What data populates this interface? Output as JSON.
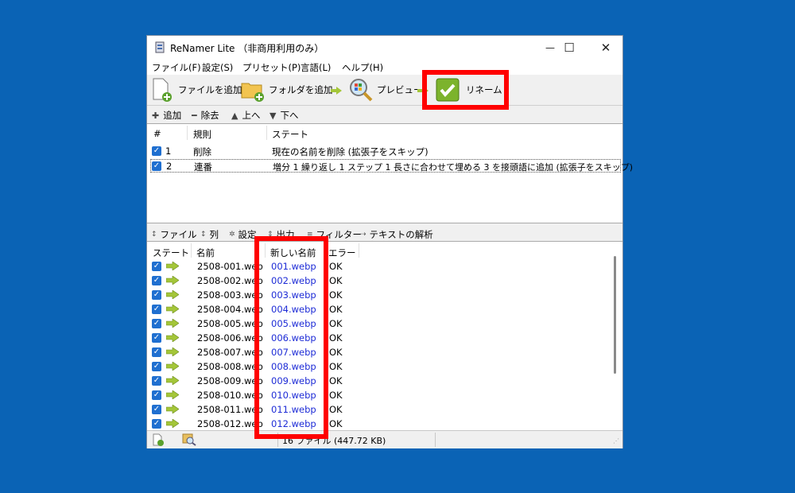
{
  "window": {
    "title": "ReNamer Lite （非商用利用のみ）",
    "minimize": "—",
    "maximize": "☐",
    "close": "✕"
  },
  "menu": [
    "ファイル(F)",
    "設定(S)",
    "プリセット(P)",
    "言語(L)",
    "ヘルプ(H)"
  ],
  "toolbar": {
    "add_files": "ファイルを追加",
    "add_folder": "フォルダを追加",
    "preview": "プレビュー",
    "rename": "リネーム"
  },
  "rules_toolbar": {
    "add": "追加",
    "remove": "除去",
    "up": "上へ",
    "down": "下へ"
  },
  "rules": {
    "headers": {
      "num": "#",
      "rule": "規則",
      "state": "ステート"
    },
    "rows": [
      {
        "num": "1",
        "rule": "削除",
        "state": "現在の名前を削除 (拡張子をスキップ)"
      },
      {
        "num": "2",
        "rule": "連番",
        "state": "増分 1 繰り返し 1 ステップ 1 長さに合わせて埋める 3 を接頭語に追加 (拡張子をスキップ)"
      }
    ]
  },
  "file_tabs": [
    "ファイル",
    "列",
    "設定",
    "出力",
    "フィルター",
    "テキストの解析"
  ],
  "files": {
    "headers": {
      "state": "ステート",
      "name": "名前",
      "new_name": "新しい名前",
      "error": "エラー"
    },
    "rows": [
      {
        "name": "2508-001.web",
        "new_name": "001.webp",
        "error": "OK"
      },
      {
        "name": "2508-002.web",
        "new_name": "002.webp",
        "error": "OK"
      },
      {
        "name": "2508-003.web",
        "new_name": "003.webp",
        "error": "OK"
      },
      {
        "name": "2508-004.web",
        "new_name": "004.webp",
        "error": "OK"
      },
      {
        "name": "2508-005.web",
        "new_name": "005.webp",
        "error": "OK"
      },
      {
        "name": "2508-006.web",
        "new_name": "006.webp",
        "error": "OK"
      },
      {
        "name": "2508-007.web",
        "new_name": "007.webp",
        "error": "OK"
      },
      {
        "name": "2508-008.web",
        "new_name": "008.webp",
        "error": "OK"
      },
      {
        "name": "2508-009.web",
        "new_name": "009.webp",
        "error": "OK"
      },
      {
        "name": "2508-010.web",
        "new_name": "010.webp",
        "error": "OK"
      },
      {
        "name": "2508-011.web",
        "new_name": "011.webp",
        "error": "OK"
      },
      {
        "name": "2508-012.web",
        "new_name": "012.webp",
        "error": "OK"
      }
    ]
  },
  "status": {
    "summary": "16 ファイル (447.72 KB)"
  },
  "colors": {
    "highlight": "#ff0000",
    "new_name_text": "#1d2bd6",
    "checkbox": "#1f6fd0",
    "desktop": "#0a63b5"
  }
}
